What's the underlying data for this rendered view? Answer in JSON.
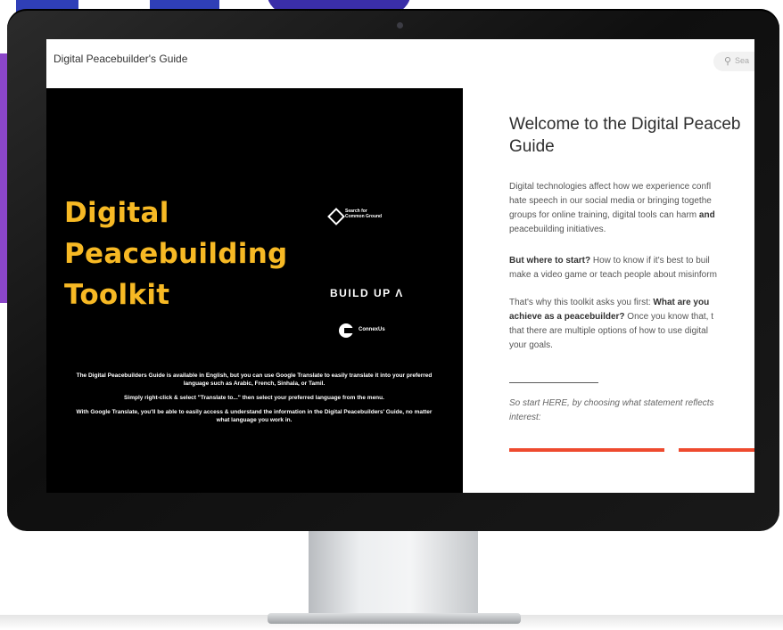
{
  "header": {
    "site_title": "Digital Peacebuilder's Guide",
    "search_placeholder": "Sea"
  },
  "hero": {
    "title_lines": [
      "Digital",
      "Peacebuilding",
      "Toolkit"
    ],
    "logos": {
      "sfcg": [
        "Search for",
        "Common Ground"
      ],
      "buildup": "BUILD UP Λ",
      "connexus": "ConnexUs"
    },
    "notes": [
      "The Digital Peacebuilders Guide is available in English, but you can use Google Translate to easily translate it into your preferred language such as Arabic, French, Sinhala, or Tamil.",
      "Simply right-click & select \"Translate to...\" then select your preferred language from the menu.",
      "With Google Translate, you'll be able to easily access & understand the information in the Digital Peacebuilders' Guide, no matter what language you work in."
    ]
  },
  "content": {
    "heading_lines": [
      "Welcome to the Digital Peaceb",
      "Guide"
    ],
    "p1_lines": [
      "Digital technologies affect how we experience confl",
      "hate speech in our social media or bringing togethe",
      "groups for online training, digital tools can harm ",
      "peacebuilding initiatives."
    ],
    "p1_bold_tail": "and",
    "p2_bold": "But where to start?",
    "p2_line1_rest": " How to know if it's best to buil",
    "p2_line2": "make a video game or teach people about misinform",
    "p3_line1": "That's why this toolkit asks you first: ",
    "p3_line1_bold": "What are you",
    "p3_line2_bold": "achieve as a peacebuilder?",
    "p3_line2_rest": " Once you know that, t",
    "p3_line3": "that there are multiple options of how to use digital",
    "p3_line4": "your goals.",
    "p4_lines": [
      "So start HERE, by choosing what statement reflects",
      "interest:"
    ]
  },
  "colors": {
    "accent_yellow": "#f7b924",
    "button_red": "#ee4a2e",
    "hero_bg": "#000000"
  }
}
